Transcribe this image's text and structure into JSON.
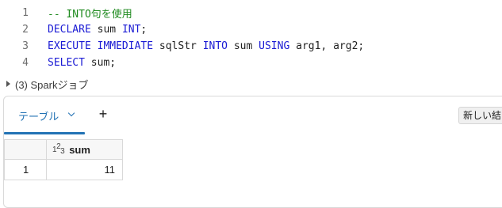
{
  "editor": {
    "lines": [
      {
        "no": "1",
        "comment": "-- INTO句を使用"
      },
      {
        "no": "2",
        "kw1": "DECLARE",
        "t1": " sum ",
        "kw2": "INT",
        "t2": ";"
      },
      {
        "no": "3",
        "kw1": "EXECUTE",
        "t1": " ",
        "kw2": "IMMEDIATE",
        "t2": " sqlStr ",
        "kw3": "INTO",
        "t3": " sum ",
        "kw4": "USING",
        "t4": " arg1, arg2;"
      },
      {
        "no": "4",
        "kw1": "SELECT",
        "t1": " sum;"
      }
    ]
  },
  "spark_jobs": {
    "label": "(3) Sparkジョブ"
  },
  "results": {
    "tab_label": "テーブル",
    "add_label": "+",
    "new_result_label": "新しい結",
    "table": {
      "column_type_icon": "123",
      "column_header": "sum",
      "rows": [
        {
          "index": "1",
          "sum": "11"
        }
      ]
    }
  },
  "colors": {
    "keyword": "#1a1ad4",
    "comment": "#1f8a1f",
    "accent": "#2272b4"
  }
}
